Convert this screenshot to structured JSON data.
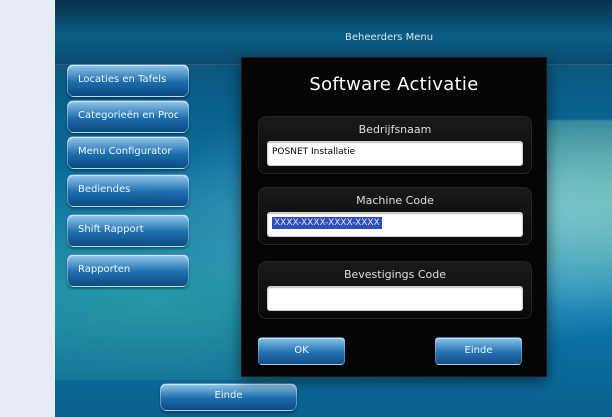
{
  "app": {
    "header_title": "Beheerders Menu"
  },
  "menu": {
    "items": [
      {
        "label": "Locaties en Tafels"
      },
      {
        "label": "Categorieën en Producten"
      },
      {
        "label": "Menu Configurator"
      },
      {
        "label": "Bediendes"
      },
      {
        "label": "Shift Rapport"
      },
      {
        "label": "Rapporten"
      }
    ],
    "bottom_einde_label": "Einde"
  },
  "dialog": {
    "title": "Software Activatie",
    "fields": {
      "company": {
        "label": "Bedrijfsnaam",
        "value": "POSNET Installatie"
      },
      "machine_code": {
        "label": "Machine Code",
        "value": "XXXX-XXXX-XXXX-XXXX"
      },
      "confirmation_code": {
        "label": "Bevestigings Code",
        "value": ""
      }
    },
    "buttons": {
      "ok": "OK",
      "einde": "Einde"
    }
  }
}
